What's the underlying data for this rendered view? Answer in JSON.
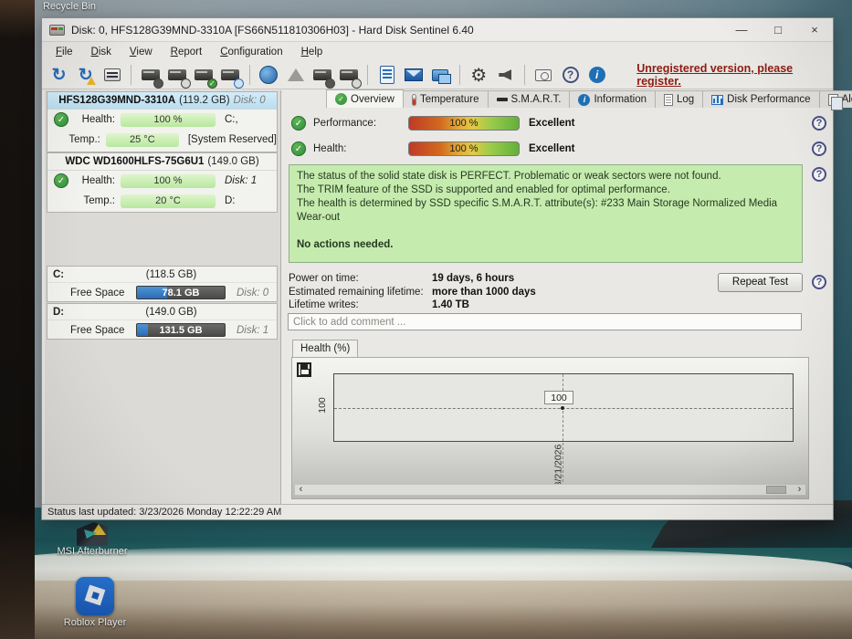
{
  "desktop": {
    "recycle_bin_label": "Recycle Bin",
    "msi_label": "MSI Afterburner",
    "roblox_label": "Roblox Player"
  },
  "window": {
    "title": "Disk: 0, HFS128G39MND-3310A [FS66N511810306H03]  -  Hard Disk Sentinel 6.40",
    "controls": {
      "minimize": "—",
      "maximize": "□",
      "close": "×"
    },
    "menu": [
      {
        "label": "File"
      },
      {
        "label": "Disk"
      },
      {
        "label": "View"
      },
      {
        "label": "Report"
      },
      {
        "label": "Configuration"
      },
      {
        "label": "Help"
      }
    ],
    "register_link": "Unregistered version, please register.",
    "status_bar": "Status last updated: 3/23/2026 Monday 12:22:29 AM"
  },
  "sidebar": {
    "disks": [
      {
        "name": "HFS128G39MND-3310A",
        "size": "(119.2 GB)",
        "disk_no": "Disk: 0",
        "health_label": "Health:",
        "health_value": "100 %",
        "health_right": "C:,",
        "temp_label": "Temp.:",
        "temp_value": "25 °C",
        "temp_right": "[System Reserved]"
      },
      {
        "name": "WDC WD1600HLFS-75G6U1",
        "size": "(149.0 GB)",
        "disk_no": "",
        "health_label": "Health:",
        "health_value": "100 %",
        "health_right": "Disk: 1",
        "temp_label": "Temp.:",
        "temp_value": "20 °C",
        "temp_right": "D:"
      }
    ],
    "partitions": [
      {
        "name": "C:",
        "size": "(118.5 GB)",
        "free_label": "Free Space",
        "free_value": "78.1 GB",
        "disk_no": "Disk: 0",
        "used_style": "width:34%"
      },
      {
        "name": "D:",
        "size": "(149.0 GB)",
        "free_label": "Free Space",
        "free_value": "131.5 GB",
        "disk_no": "Disk: 1",
        "used_style": "width:12%"
      }
    ]
  },
  "tabs": [
    {
      "label": "Overview"
    },
    {
      "label": "Temperature"
    },
    {
      "label": "S.M.A.R.T."
    },
    {
      "label": "Information"
    },
    {
      "label": "Log"
    },
    {
      "label": "Disk Performance"
    },
    {
      "label": "Alerts"
    }
  ],
  "overview": {
    "performance_label": "Performance:",
    "performance_value": "100 %",
    "performance_rating": "Excellent",
    "health_label": "Health:",
    "health_value": "100 %",
    "health_rating": "Excellent",
    "status_lines": [
      "The status of the solid state disk is PERFECT. Problematic or weak sectors were not found.",
      "The TRIM feature of the SSD is supported and enabled for optimal performance.",
      "The health is determined by SSD specific S.M.A.R.T. attribute(s):  #233 Main Storage Normalized Media Wear-out"
    ],
    "no_actions": "No actions needed.",
    "stats": [
      {
        "label": "Power on time:",
        "value": "19 days, 6 hours"
      },
      {
        "label": "Estimated remaining lifetime:",
        "value": "more than 1000 days"
      },
      {
        "label": "Lifetime writes:",
        "value": "1.40 TB"
      }
    ],
    "repeat_button": "Repeat Test",
    "comment_placeholder": "Click to add comment ..."
  },
  "chart": {
    "tab_label": "Health (%)",
    "y_axis_label": "100",
    "point_label": "100",
    "x_axis_label": "3/21/2026",
    "series": "Health (%)",
    "points": [
      {
        "date": "3/21/2026",
        "value": 100
      }
    ]
  },
  "colors": {
    "register_link_red": "#8e1b12",
    "health_bar_green": "#c9eeb0",
    "status_box_green": "#c6ebae",
    "used_space_blue": "#2f77bf",
    "meter_gradient_ends": [
      "#bf3a28",
      "#62b03c"
    ]
  }
}
